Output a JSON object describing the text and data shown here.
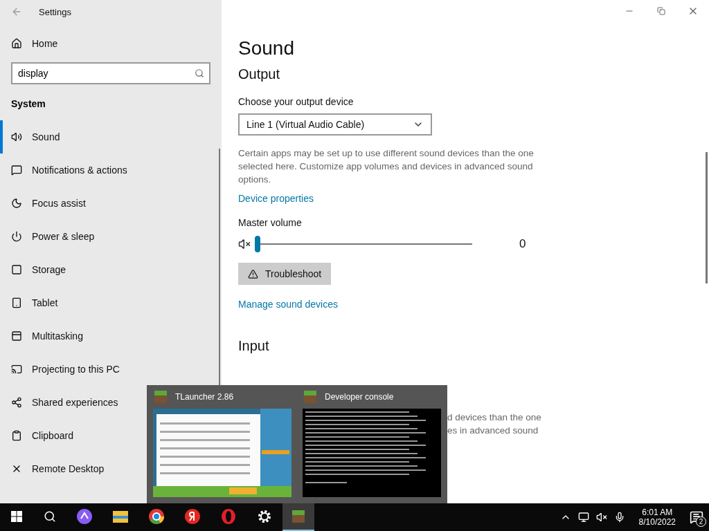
{
  "window": {
    "title": "Settings"
  },
  "sidebar": {
    "home": "Home",
    "search": {
      "value": "display"
    },
    "section": "System",
    "items": [
      {
        "label": "Sound",
        "selected": true
      },
      {
        "label": "Notifications & actions",
        "selected": false
      },
      {
        "label": "Focus assist",
        "selected": false
      },
      {
        "label": "Power & sleep",
        "selected": false
      },
      {
        "label": "Storage",
        "selected": false
      },
      {
        "label": "Tablet",
        "selected": false
      },
      {
        "label": "Multitasking",
        "selected": false
      },
      {
        "label": "Projecting to this PC",
        "selected": false
      },
      {
        "label": "Shared experiences",
        "selected": false
      },
      {
        "label": "Clipboard",
        "selected": false
      },
      {
        "label": "Remote Desktop",
        "selected": false
      }
    ]
  },
  "page": {
    "title": "Sound",
    "output": {
      "heading": "Output",
      "device_label": "Choose your output device",
      "device": "Line 1 (Virtual Audio Cable)",
      "description": "Certain apps may be set up to use different sound devices than the one selected here. Customize app volumes and devices in advanced sound options.",
      "device_properties_link": "Device properties",
      "volume_label": "Master volume",
      "muted": true,
      "level": 0,
      "reading": "0",
      "troubleshoot": "Troubleshoot",
      "manage_link": "Manage sound devices"
    },
    "input": {
      "heading": "Input",
      "fragment_lines": [
        "d devices than the one",
        "es in advanced sound"
      ]
    }
  },
  "taskbar_preview": {
    "windows": [
      {
        "title": "TLauncher 2.86",
        "kind": "launcher"
      },
      {
        "title": "Developer console",
        "kind": "console"
      }
    ]
  },
  "taskbar": {
    "apps": [
      {
        "kind": "assistant",
        "active": false
      },
      {
        "kind": "folder",
        "active": false
      },
      {
        "kind": "chrome",
        "active": false
      },
      {
        "kind": "yandex",
        "active": false
      },
      {
        "kind": "opera",
        "active": false
      },
      {
        "kind": "gear",
        "active": false
      },
      {
        "kind": "block",
        "active": true
      }
    ],
    "time": "6:01 AM",
    "date": "8/10/2022",
    "notifications": "2"
  }
}
